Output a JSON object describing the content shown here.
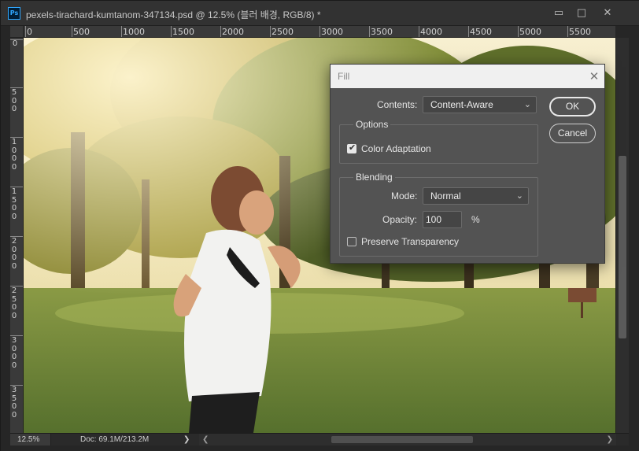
{
  "app": {
    "logo_text": "Ps",
    "document_title": "pexels-tirachard-kumtanom-347134.psd @ 12.5% (블러 배경, RGB/8) *",
    "window_controls": {
      "minimize": "▭",
      "maximize": "□",
      "close": "✕"
    }
  },
  "rulers": {
    "horizontal_labels": [
      "0",
      "500",
      "1000",
      "1500",
      "2000",
      "2500",
      "3000",
      "3500",
      "4000",
      "4500",
      "5000",
      "5500"
    ],
    "vertical_labels": [
      "0",
      "500",
      "1000",
      "1500",
      "2000",
      "2500",
      "3000",
      "3500"
    ]
  },
  "status_bar": {
    "zoom": "12.5%",
    "doc_info": "Doc: 69.1M/213.2M",
    "arrow": "❯"
  },
  "dialog": {
    "title": "Fill",
    "close": "✕",
    "contents_label": "Contents:",
    "contents_value": "Content-Aware",
    "options_title": "Options",
    "color_adaptation_label": "Color Adaptation",
    "color_adaptation_checked": true,
    "blending_title": "Blending",
    "mode_label": "Mode:",
    "mode_value": "Normal",
    "opacity_label": "Opacity:",
    "opacity_value": "100",
    "opacity_unit": "%",
    "preserve_transparency_label": "Preserve Transparency",
    "preserve_transparency_checked": false,
    "ok_label": "OK",
    "cancel_label": "Cancel"
  },
  "colors": {
    "panel_bg": "#535353",
    "app_bg": "#262626",
    "dialog_titlebar": "#f0f0f0"
  }
}
